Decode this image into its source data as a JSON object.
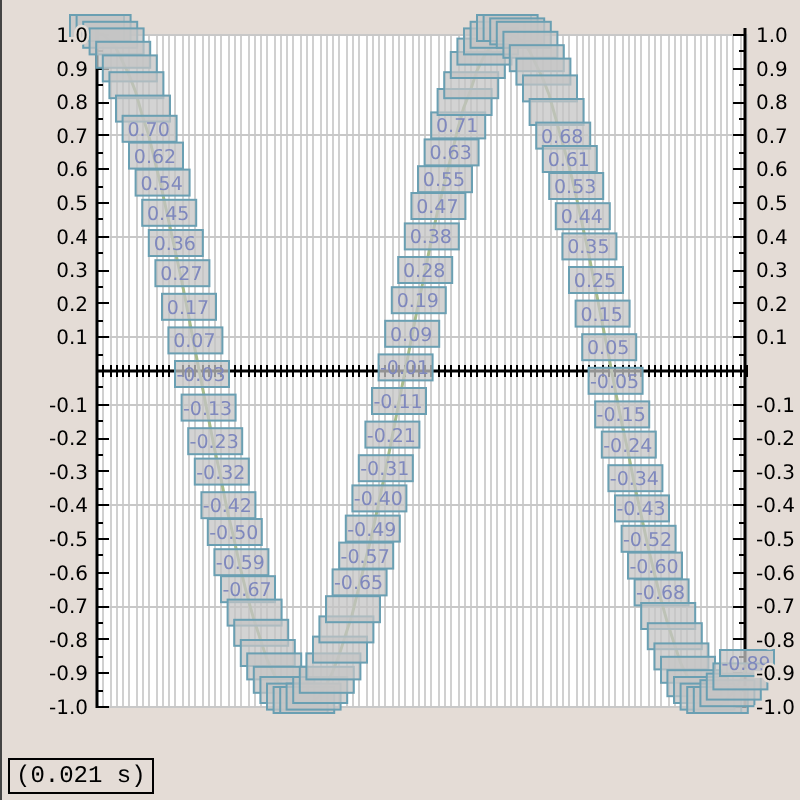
{
  "chart": {
    "chart_data": {
      "type": "line",
      "categories": [
        null,
        null,
        null,
        null,
        null,
        null,
        null,
        null,
        null,
        null,
        null,
        null,
        null,
        null,
        null,
        null,
        null,
        null,
        null,
        null,
        null,
        null,
        null,
        null,
        null,
        null,
        null,
        null,
        null,
        null,
        null,
        null,
        null,
        null,
        null,
        null,
        null,
        null,
        null,
        null,
        null,
        null,
        null,
        null,
        null,
        null,
        null,
        null,
        null,
        null,
        null,
        null,
        null,
        null,
        null,
        null,
        null,
        null,
        null,
        null,
        null,
        null,
        null,
        null,
        null,
        null,
        null,
        null,
        null,
        null,
        null,
        null,
        null,
        null,
        null,
        null,
        null,
        null,
        null,
        null,
        null,
        null,
        null,
        null,
        null,
        null,
        null,
        null,
        null,
        null,
        null,
        null,
        null,
        null,
        null,
        null,
        null,
        null,
        null,
        null
      ],
      "series": [
        {
          "color": "#a8bc8c",
          "values": [
            1.0,
            1.0,
            0.98,
            0.96,
            0.92,
            0.88,
            0.83,
            0.76,
            0.7,
            0.62,
            0.54,
            0.45,
            0.36,
            0.27,
            0.17,
            0.07,
            -0.03,
            -0.13,
            -0.23,
            -0.32,
            -0.42,
            -0.5,
            -0.59,
            -0.67,
            -0.74,
            -0.8,
            -0.86,
            -0.9,
            -0.94,
            -0.97,
            -0.99,
            -1.0,
            -1.0,
            -0.99,
            -0.97,
            -0.94,
            -0.9,
            -0.85,
            -0.79,
            -0.73,
            -0.65,
            -0.57,
            -0.49,
            -0.4,
            -0.31,
            -0.21,
            -0.11,
            -0.01,
            0.09,
            0.19,
            0.28,
            0.38,
            0.47,
            0.55,
            0.63,
            0.71,
            0.78,
            0.83,
            0.89,
            0.93,
            0.96,
            0.98,
            1.0,
            1.0,
            0.99,
            0.98,
            0.95,
            0.91,
            0.87,
            0.82,
            0.75,
            0.68,
            0.61,
            0.53,
            0.44,
            0.35,
            0.25,
            0.15,
            0.05,
            -0.05,
            -0.15,
            -0.24,
            -0.34,
            -0.43,
            -0.52,
            -0.6,
            -0.68,
            -0.75,
            -0.81,
            -0.87,
            -0.91,
            -0.95,
            -0.97,
            -0.99,
            -1.0,
            -1.0,
            -0.98,
            -0.96,
            -0.93,
            -0.89
          ]
        }
      ],
      "ylim": [
        -1,
        1
      ],
      "yticks": [
        {
          "value": 1,
          "label": "1.0"
        },
        {
          "value": 0.9,
          "label": "0.9"
        },
        {
          "value": 0.8,
          "label": "0.8"
        },
        {
          "value": 0.7,
          "label": "0.7"
        },
        {
          "value": 0.6,
          "label": "0.6"
        },
        {
          "value": 0.5,
          "label": "0.5"
        },
        {
          "value": 0.4,
          "label": "0.4"
        },
        {
          "value": 0.3,
          "label": "0.3"
        },
        {
          "value": 0.2,
          "label": "0.2"
        },
        {
          "value": 0.1,
          "label": "0.1"
        },
        {
          "value": -0.1,
          "label": "-0.1"
        },
        {
          "value": -0.2,
          "label": "-0.2"
        },
        {
          "value": -0.3,
          "label": "-0.3"
        },
        {
          "value": -0.4,
          "label": "-0.4"
        },
        {
          "value": -0.5,
          "label": "-0.5"
        },
        {
          "value": -0.6,
          "label": "-0.6"
        },
        {
          "value": -0.7,
          "label": "-0.7"
        },
        {
          "value": -0.8,
          "label": "-0.8"
        },
        {
          "value": -0.9,
          "label": "-0.9"
        },
        {
          "value": -1,
          "label": "-1.0"
        }
      ],
      "grid": true,
      "value_labels": [
        null,
        null,
        null,
        null,
        null,
        null,
        null,
        null,
        "0.70",
        "0.62",
        "0.54",
        "0.45",
        "0.36",
        "0.27",
        "0.17",
        "0.07",
        "-0.03",
        "-0.13",
        "-0.23",
        "-0.32",
        "-0.42",
        "-0.50",
        "-0.59",
        "-0.67",
        null,
        null,
        null,
        null,
        null,
        null,
        null,
        null,
        null,
        null,
        null,
        null,
        null,
        null,
        null,
        null,
        "-0.65",
        "-0.57",
        "-0.49",
        "-0.40",
        "-0.31",
        "-0.21",
        "-0.11",
        "-0.01",
        "0.09",
        "0.19",
        "0.28",
        "0.38",
        "0.47",
        "0.55",
        "0.63",
        "0.71",
        null,
        null,
        null,
        null,
        null,
        null,
        null,
        null,
        null,
        null,
        null,
        null,
        null,
        null,
        null,
        "0.68",
        "0.61",
        "0.53",
        "0.44",
        "0.35",
        "0.25",
        "0.15",
        "0.05",
        "-0.05",
        "-0.15",
        "-0.24",
        "-0.34",
        "-0.43",
        "-0.52",
        "-0.60",
        "-0.68",
        null,
        null,
        null,
        null,
        null,
        null,
        null,
        null,
        null,
        null,
        null,
        null,
        "-0.89"
      ]
    }
  },
  "status": "(0.021 s)"
}
